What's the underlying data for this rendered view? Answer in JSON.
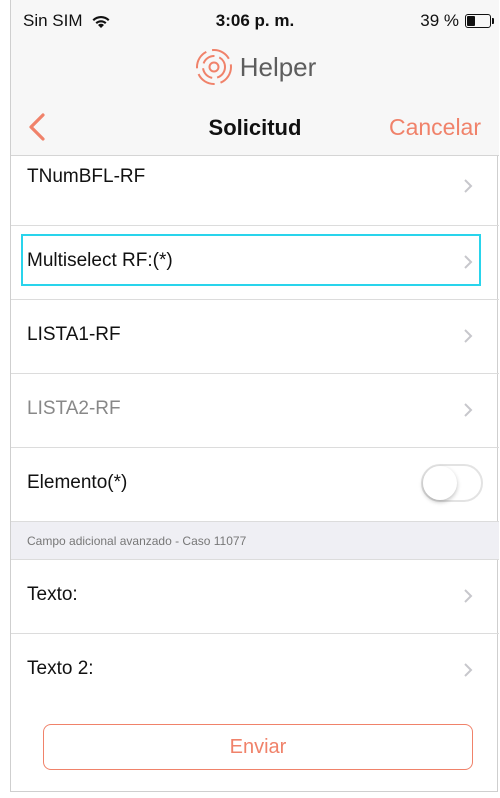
{
  "status_bar": {
    "carrier": "Sin SIM",
    "time": "3:06 p. m.",
    "battery_text": "39 %",
    "battery_level": 0.39
  },
  "brand": {
    "name": "Helper",
    "accent_color": "#f0826a"
  },
  "nav": {
    "title": "Solicitud",
    "cancel_label": "Cancelar"
  },
  "rows": [
    {
      "label": "TNumBFL-RF",
      "type": "disclosure"
    },
    {
      "label": "Multiselect RF:(*)",
      "type": "disclosure",
      "highlighted": true
    },
    {
      "label": "LISTA1-RF",
      "type": "disclosure"
    },
    {
      "label": "LISTA2-RF",
      "type": "disclosure",
      "muted": true
    },
    {
      "label": "Elemento(*)",
      "type": "toggle",
      "value": false
    }
  ],
  "section": {
    "header": "Campo adicional avanzado - Caso 11077",
    "rows": [
      {
        "label": "Texto:",
        "type": "disclosure"
      },
      {
        "label": "Texto 2:",
        "type": "disclosure"
      }
    ]
  },
  "submit_label": "Enviar"
}
